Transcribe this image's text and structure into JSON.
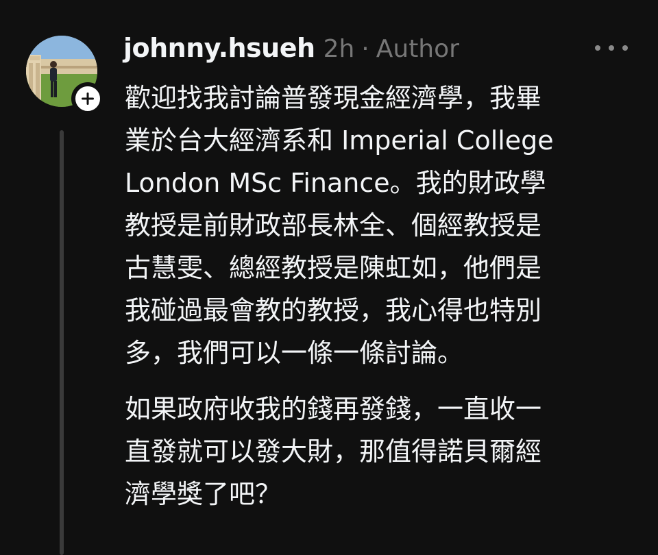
{
  "post": {
    "username": "johnny.hsueh",
    "time_ago": "2h",
    "separator": "·",
    "role": "Author",
    "more_icon": "more-horizontal-icon",
    "follow_icon": "plus-icon",
    "paragraphs": [
      {
        "lines": [
          "歡迎找我討論普發現金經濟學，我畢",
          "業於台大經濟系和 Imperial College",
          "London MSc Finance。我的財政學",
          "教授是前財政部長林全、個經教授是",
          "古慧雯、總經教授是陳虹如，他們是",
          "我碰過最會教的教授，我心得也特別",
          "多，我們可以一條一條討論。"
        ]
      },
      {
        "lines": [
          "如果政府收我的錢再發錢，一直收一",
          "直發就可以發大財，那值得諾貝爾經",
          "濟學獎了吧？"
        ]
      }
    ]
  },
  "colors": {
    "background": "#101010",
    "text": "#f3f5f7",
    "muted": "#777777",
    "thread_line": "#3a3a3a",
    "badge": "#ffffff"
  }
}
